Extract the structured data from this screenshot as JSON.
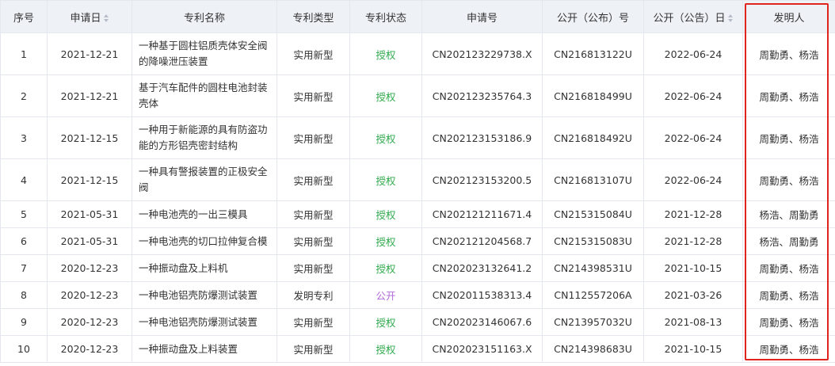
{
  "table": {
    "headers": [
      "序号",
      "申请日",
      "专利名称",
      "专利类型",
      "专利状态",
      "申请号",
      "公开（公布）号",
      "公开（公告）日",
      "发明人"
    ],
    "rows": [
      {
        "no": "1",
        "date": "2021-12-21",
        "name": "一种基于圆柱铝质壳体安全阀的降噪泄压装置",
        "type": "实用新型",
        "status": "授权",
        "app_no": "CN202123229738.X",
        "pub_no": "CN216813122U",
        "pub_date": "2022-06-24",
        "inventor": "周勤勇、杨浩"
      },
      {
        "no": "2",
        "date": "2021-12-21",
        "name": "基于汽车配件的圆柱电池封装壳体",
        "type": "实用新型",
        "status": "授权",
        "app_no": "CN202123235764.3",
        "pub_no": "CN216818499U",
        "pub_date": "2022-06-24",
        "inventor": "周勤勇、杨浩"
      },
      {
        "no": "3",
        "date": "2021-12-15",
        "name": "一种用于新能源的具有防盗功能的方形铝壳密封结构",
        "type": "实用新型",
        "status": "授权",
        "app_no": "CN202123153186.9",
        "pub_no": "CN216818492U",
        "pub_date": "2022-06-24",
        "inventor": "周勤勇、杨浩"
      },
      {
        "no": "4",
        "date": "2021-12-15",
        "name": "一种具有警报装置的正极安全阀",
        "type": "实用新型",
        "status": "授权",
        "app_no": "CN202123153200.5",
        "pub_no": "CN216813107U",
        "pub_date": "2022-06-24",
        "inventor": "周勤勇、杨浩"
      },
      {
        "no": "5",
        "date": "2021-05-31",
        "name": "一种电池壳的一出三模具",
        "type": "实用新型",
        "status": "授权",
        "app_no": "CN202121211671.4",
        "pub_no": "CN215315084U",
        "pub_date": "2021-12-28",
        "inventor": "杨浩、周勤勇"
      },
      {
        "no": "6",
        "date": "2021-05-31",
        "name": "一种电池壳的切口拉伸复合模",
        "type": "实用新型",
        "status": "授权",
        "app_no": "CN202121204568.7",
        "pub_no": "CN215315083U",
        "pub_date": "2021-12-28",
        "inventor": "杨浩、周勤勇"
      },
      {
        "no": "7",
        "date": "2020-12-23",
        "name": "一种振动盘及上料机",
        "type": "实用新型",
        "status": "授权",
        "app_no": "CN202023132641.2",
        "pub_no": "CN214398531U",
        "pub_date": "2021-10-15",
        "inventor": "周勤勇、杨浩"
      },
      {
        "no": "8",
        "date": "2020-12-23",
        "name": "一种电池铝壳防爆测试装置",
        "type": "发明专利",
        "status": "公开",
        "app_no": "CN202011538313.4",
        "pub_no": "CN112557206A",
        "pub_date": "2021-03-26",
        "inventor": "周勤勇、杨浩"
      },
      {
        "no": "9",
        "date": "2020-12-23",
        "name": "一种电池铝壳防爆测试装置",
        "type": "实用新型",
        "status": "授权",
        "app_no": "CN202023146067.6",
        "pub_no": "CN213957032U",
        "pub_date": "2021-08-13",
        "inventor": "周勤勇、杨浩"
      },
      {
        "no": "10",
        "date": "2020-12-23",
        "name": "一种振动盘及上料装置",
        "type": "实用新型",
        "status": "授权",
        "app_no": "CN202023151163.X",
        "pub_no": "CN214398683U",
        "pub_date": "2021-10-15",
        "inventor": "周勤勇、杨浩"
      }
    ]
  },
  "colors": {
    "header_bg": "#eef2f7",
    "border": "#e4e8ee",
    "status_granted": "#2ea94b",
    "status_public": "#b06ad8",
    "highlight_box": "#e0241e"
  },
  "icons": {
    "sort": "sort-icon"
  }
}
